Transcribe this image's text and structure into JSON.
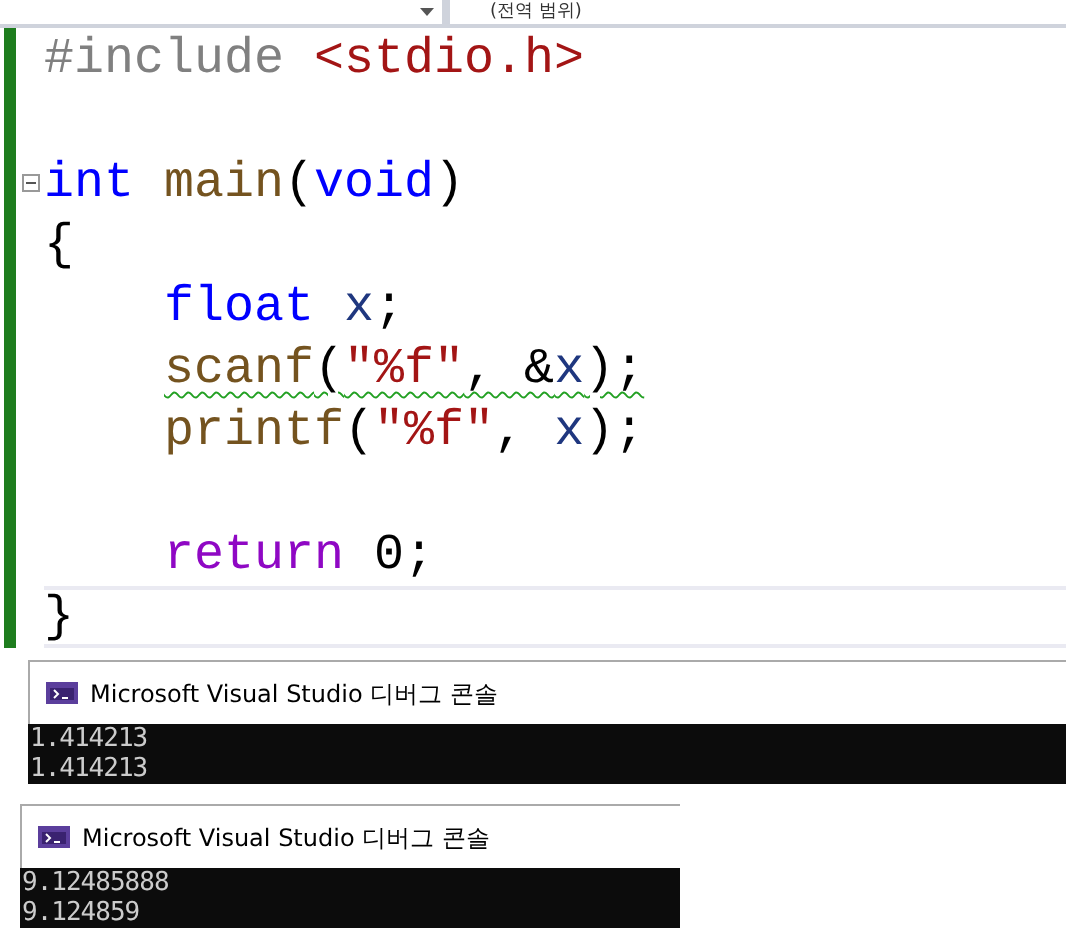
{
  "toolbar": {
    "scope_dropdown": "(전역 범위)"
  },
  "code_lines": [
    {
      "foldable": false,
      "indented": false,
      "warning": false,
      "current": false,
      "tokens": [
        {
          "kind": "preproc",
          "text": "#include "
        },
        {
          "kind": "header",
          "text": "<stdio.h>"
        }
      ]
    },
    {
      "foldable": false,
      "current": false
    },
    {
      "foldable": true,
      "indented": false,
      "warning": false,
      "current": false,
      "tokens": [
        {
          "kind": "keyword",
          "text": "int "
        },
        {
          "kind": "function",
          "text": "main"
        },
        {
          "kind": "plain",
          "text": "("
        },
        {
          "kind": "keyword",
          "text": "void"
        },
        {
          "kind": "plain",
          "text": ")"
        }
      ]
    },
    {
      "foldable": false,
      "indented": false,
      "warning": false,
      "current": false,
      "tokens": [
        {
          "kind": "plain",
          "text": "{"
        }
      ]
    },
    {
      "foldable": false,
      "indented": true,
      "warning": false,
      "current": false,
      "tokens": [
        {
          "kind": "keyword",
          "text": "float "
        },
        {
          "kind": "variable",
          "text": "x"
        },
        {
          "kind": "plain",
          "text": ";"
        }
      ]
    },
    {
      "foldable": false,
      "indented": true,
      "warning": true,
      "current": false,
      "tokens": [
        {
          "kind": "function",
          "text": "scanf"
        },
        {
          "kind": "plain",
          "text": "("
        },
        {
          "kind": "string",
          "text": "\"%f\""
        },
        {
          "kind": "plain",
          "text": ", &"
        },
        {
          "kind": "variable",
          "text": "x"
        },
        {
          "kind": "plain",
          "text": ");"
        }
      ]
    },
    {
      "foldable": false,
      "indented": true,
      "warning": false,
      "current": false,
      "tokens": [
        {
          "kind": "function",
          "text": "printf"
        },
        {
          "kind": "plain",
          "text": "("
        },
        {
          "kind": "string",
          "text": "\"%f\""
        },
        {
          "kind": "plain",
          "text": ", "
        },
        {
          "kind": "variable",
          "text": "x"
        },
        {
          "kind": "plain",
          "text": ");"
        }
      ]
    },
    {
      "foldable": false,
      "current": false
    },
    {
      "foldable": false,
      "indented": true,
      "warning": false,
      "current": false,
      "tokens": [
        {
          "kind": "control",
          "text": "return "
        },
        {
          "kind": "plain",
          "text": "0;"
        }
      ]
    },
    {
      "foldable": false,
      "indented": false,
      "warning": false,
      "current": true,
      "tokens": [
        {
          "kind": "plain",
          "text": "}"
        }
      ]
    }
  ],
  "consoles": [
    {
      "title": "Microsoft Visual Studio 디버그 콘솔",
      "output": [
        "1.414213",
        "1.414213"
      ]
    },
    {
      "title": "Microsoft Visual Studio 디버그 콘솔",
      "output": [
        "9.12485888",
        "9.124859"
      ]
    }
  ]
}
